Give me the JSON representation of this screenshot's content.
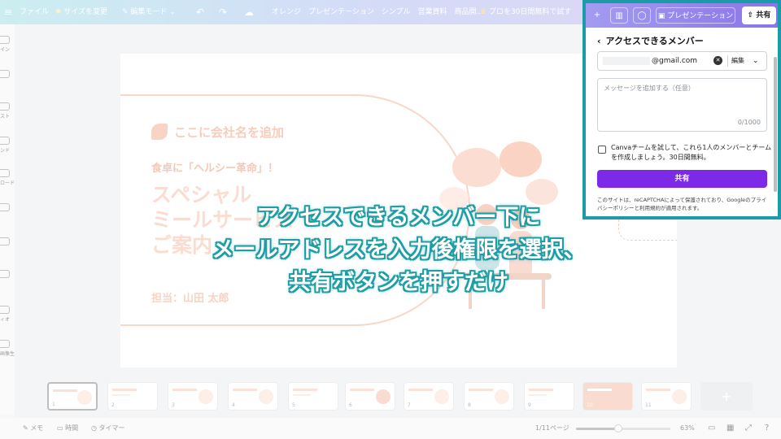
{
  "topbar": {
    "file_label": "ファイル",
    "resize_label": "サイズを変更",
    "edit_mode_label": "編集モード",
    "doc_title": "オレンジ　プレゼンテーション　シンプル　営業資料　商品開...",
    "pro_trial_label": "プロを30日間無料で試す"
  },
  "share_panel": {
    "add_label": "+",
    "present_label": "プレゼンテーション",
    "share_label": "共有",
    "title": "アクセスできるメンバー",
    "email_value": "@gmail.com",
    "permission_label": "編集",
    "message_placeholder": "メッセージを追加する（任意）",
    "message_counter": "0/1000",
    "team_offer_text": "Canvaチームを試して、これら1人のメンバーとチームを作成しましょう。30日間無料。",
    "share_button_label": "共有",
    "legal_text": "このサイトは、reCAPTCHAによって保護されており、Googleのプライバシーポリシーと利用規約が適用されます。"
  },
  "left_rail": {
    "items": [
      "イン",
      "",
      "スト",
      "ンド",
      "ロード",
      "",
      "",
      "",
      "ィオ",
      "画像生成"
    ]
  },
  "slide": {
    "company_placeholder": "ここに会社名を追加",
    "tagline": "食卓に「ヘルシー革命」！",
    "title": "スペシャル\nミールサービス\nご案内",
    "presenter": "担当：山田 太郎"
  },
  "thumbnails": {
    "numbers": [
      "1",
      "2",
      "3",
      "4",
      "5",
      "6",
      "7",
      "8",
      "9",
      "10",
      "11"
    ],
    "add_label": "+"
  },
  "bottombar": {
    "memo_label": "メモ",
    "time_label": "時間",
    "timer_label": "タイマー",
    "page_indicator": "1/11ページ",
    "zoom_label": "63%",
    "zoom_level": 0.45
  },
  "caption": {
    "line1": "アクセスできるメンバー下に",
    "line2": "メールアドレスを入力後権限を選択、",
    "line3": "共有ボタンを押すだけ"
  },
  "colors": {
    "highlight_border": "#1b9aa8",
    "share_button": "#7d2ae8",
    "slide_accent": "#f2a789"
  }
}
